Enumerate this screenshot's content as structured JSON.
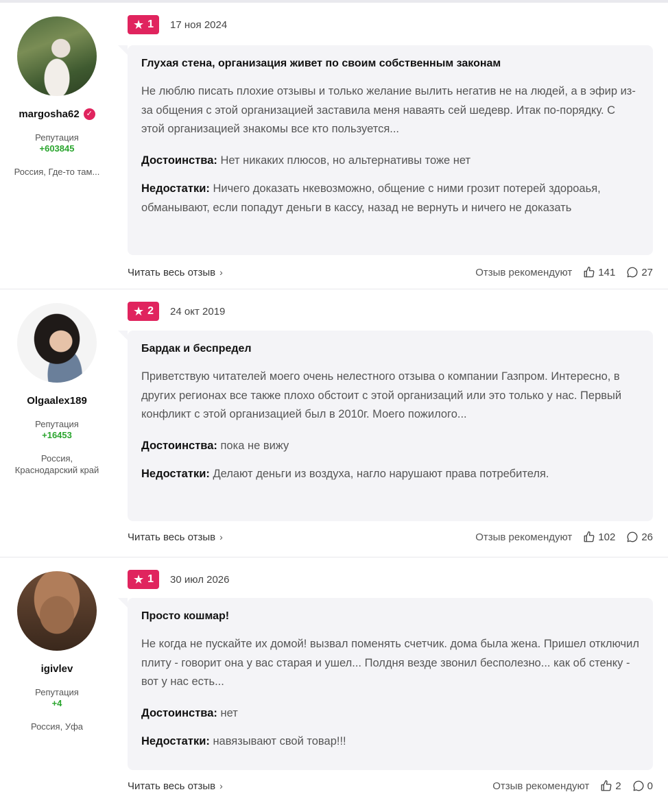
{
  "common": {
    "reputation_label": "Репутация",
    "pros_label": "Достоинства:",
    "cons_label": "Недостатки:",
    "read_more": "Читать весь отзыв",
    "recommend_label": "Отзыв рекомендуют",
    "accent_color": "#e0245e",
    "reputation_color": "#2aa52e"
  },
  "reviews": [
    {
      "author": "margosha62",
      "verified": true,
      "reputation": "+603845",
      "location": "Россия, Где-то там...",
      "rating": "1",
      "date": "17 ноя 2024",
      "title": "Глухая стена, организация живет по своим собственным законам",
      "text": "Не люблю писать плохие отзывы и только желание вылить негатив не на людей, а в эфир из-за общения с этой организацией заставила меня наваять сей шедевр. Итак по-порядку. С этой организацией знакомы все кто пользуется...",
      "pros": "Нет никаких плюсов, но альтернативы тоже нет",
      "cons": "Ничего доказать нкевозможно, общение с ними грозит потерей здороаья, обманывают, если попадут деньги в кассу, назад не вернуть и ничего не доказать",
      "likes": "141",
      "comments": "27"
    },
    {
      "author": "Olgaalex189",
      "verified": false,
      "reputation": "+16453",
      "location": "Россия, Краснодарский край",
      "rating": "2",
      "date": "24 окт 2019",
      "title": "Бардак и беспредел",
      "text": "Приветствую читателей моего очень нелестного отзыва о компании Газпром. Интересно, в других регионах все также плохо обстоит с этой организаций или это только у нас. Первый конфликт с этой организацией был в 2010г. Моего пожилого...",
      "pros": "пока не вижу",
      "cons": "Делают деньги из воздуха, нагло нарушают права потребителя.",
      "likes": "102",
      "comments": "26"
    },
    {
      "author": "igivlev",
      "verified": false,
      "reputation": "+4",
      "location": "Россия, Уфа",
      "rating": "1",
      "date": "30 июл 2026",
      "title": "Просто кошмар!",
      "text": "Не когда не пускайте их домой! вызвал поменять счетчик. дома была жена. Пришел отключил плиту - говорит она у вас старая и ушел... Полдня везде звонил бесполезно... как об стенку - вот у нас есть...",
      "pros": "нет",
      "cons": "навязывают свой товар!!!",
      "likes": "2",
      "comments": "0"
    }
  ]
}
